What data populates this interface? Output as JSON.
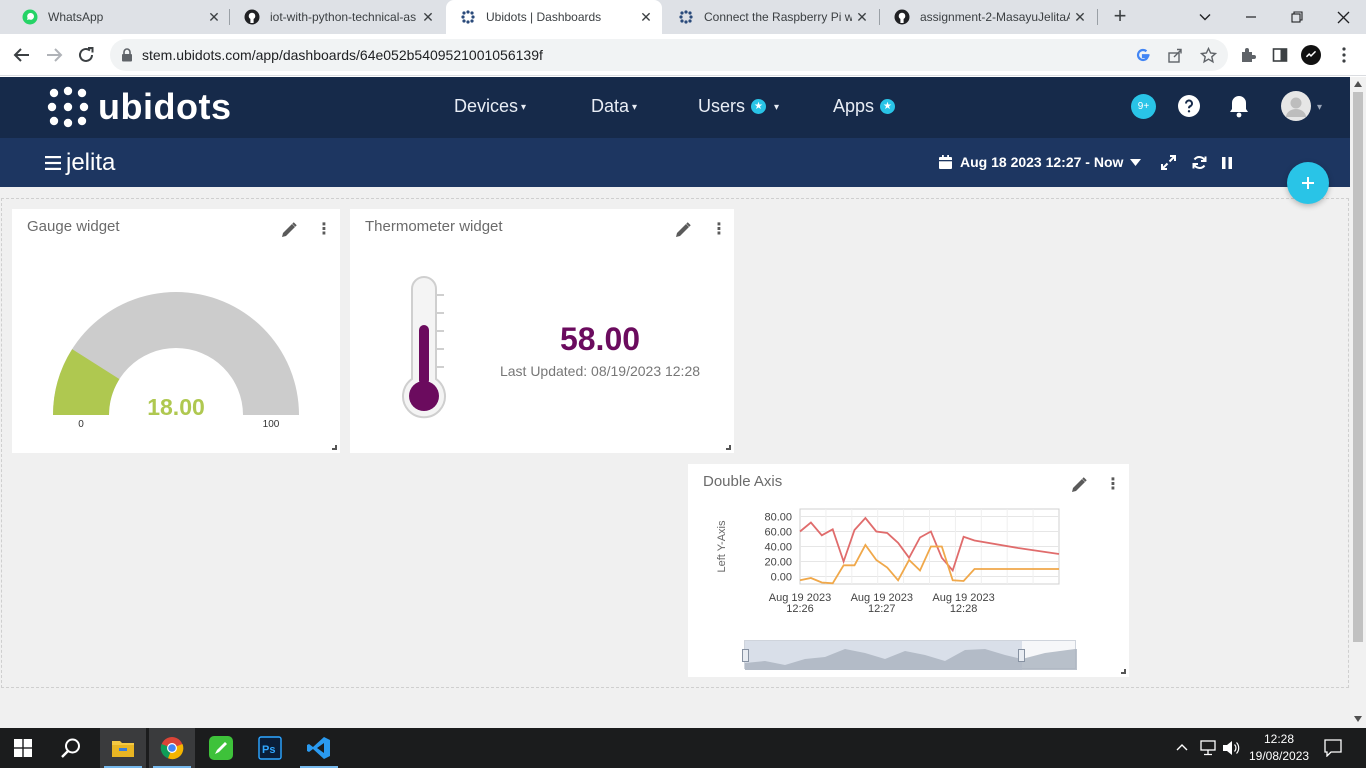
{
  "browser": {
    "tabs": [
      {
        "label": "WhatsApp",
        "icon": "whatsapp-icon",
        "active": false
      },
      {
        "label": "iot-with-python-technical-as",
        "icon": "github-icon",
        "active": false
      },
      {
        "label": "Ubidots | Dashboards",
        "icon": "ubidots-icon",
        "active": true
      },
      {
        "label": "Connect the Raspberry Pi wit",
        "icon": "ubidots-icon",
        "active": false
      },
      {
        "label": "assignment-2-MasayuJelitaA",
        "icon": "github-icon",
        "active": false
      }
    ],
    "url": "stem.ubidots.com/app/dashboards/64e052b5409521001056139f"
  },
  "ubidots": {
    "logo_text": "ubidots",
    "menu": {
      "devices": "Devices",
      "data": "Data",
      "users": "Users",
      "apps": "Apps"
    },
    "notifications_badge": "9+",
    "dashboard_name": "jelita",
    "date_range": "Aug 18 2023 12:27 - Now",
    "accent_color": "#29c4e7"
  },
  "widgets": {
    "gauge": {
      "title": "Gauge widget",
      "value": 18.0,
      "value_text": "18.00",
      "min_label": "0",
      "max_label": "100",
      "fill_color": "#afc850",
      "track_color": "#cccccc"
    },
    "thermometer": {
      "title": "Thermometer widget",
      "value_text": "58.00",
      "last_updated": "Last Updated: 08/19/2023 12:28",
      "value_color": "#6b0b5e"
    },
    "double_axis": {
      "title": "Double Axis"
    }
  },
  "chart_data": {
    "type": "line",
    "title": "",
    "ylabel": "Left Y-Axis",
    "ylim": [
      -10,
      90
    ],
    "y_ticks": [
      "80.00",
      "60.00",
      "40.00",
      "20.00",
      "0.00"
    ],
    "x_ticks": [
      {
        "line1": "Aug 19 2023",
        "line2": "12:26"
      },
      {
        "line1": "Aug 19 2023",
        "line2": "12:27"
      },
      {
        "line1": "Aug 19 2023",
        "line2": "12:28"
      }
    ],
    "grid": true,
    "series": [
      {
        "color": "#e06c6c",
        "x": [
          "12:26:00",
          "12:26:08",
          "12:26:16",
          "12:26:24",
          "12:26:32",
          "12:26:40",
          "12:26:48",
          "12:26:56",
          "12:27:04",
          "12:27:12",
          "12:27:20",
          "12:27:28",
          "12:27:36",
          "12:27:44",
          "12:27:52",
          "12:28:00",
          "12:28:08",
          "12:28:40",
          "12:29:10"
        ],
        "values": [
          60,
          72,
          55,
          63,
          20,
          62,
          78,
          60,
          58,
          45,
          25,
          52,
          60,
          25,
          8,
          53,
          48,
          38,
          30
        ]
      },
      {
        "color": "#f0a84a",
        "x": [
          "12:26:00",
          "12:26:08",
          "12:26:16",
          "12:26:24",
          "12:26:32",
          "12:26:40",
          "12:26:48",
          "12:26:56",
          "12:27:04",
          "12:27:12",
          "12:27:20",
          "12:27:28",
          "12:27:36",
          "12:27:44",
          "12:27:52",
          "12:28:00",
          "12:28:08",
          "12:28:40",
          "12:29:10"
        ],
        "values": [
          -5,
          -2,
          -8,
          -9,
          15,
          15,
          42,
          22,
          12,
          -5,
          22,
          8,
          40,
          40,
          -5,
          -6,
          10,
          10,
          10
        ]
      }
    ]
  },
  "taskbar": {
    "time": "12:28",
    "date": "19/08/2023"
  }
}
